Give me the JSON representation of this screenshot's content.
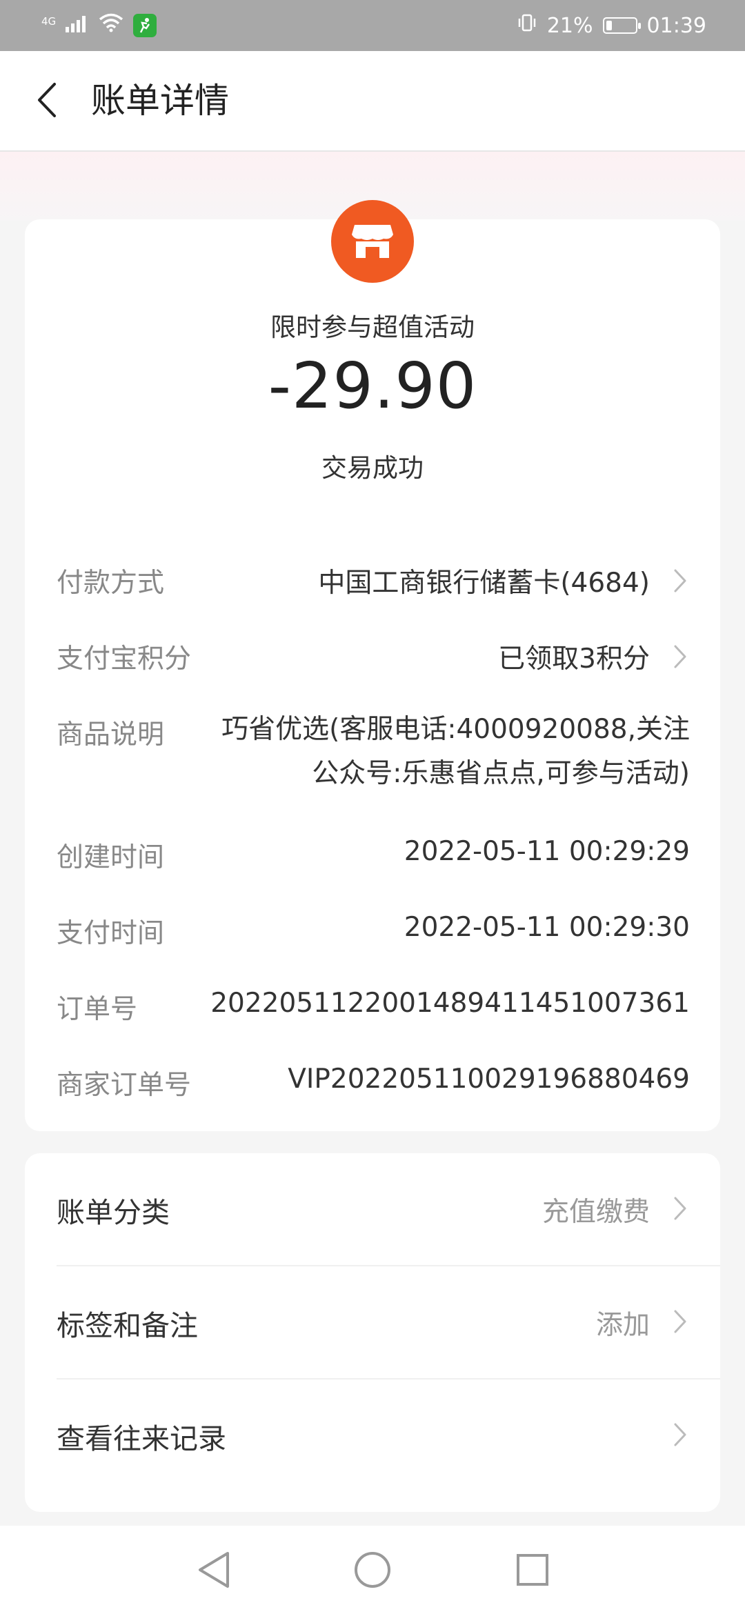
{
  "status_bar": {
    "network": "4G",
    "battery_percent": "21%",
    "battery_level": 0.21,
    "time": "01:39",
    "icons": [
      "signal-icon",
      "wifi-icon",
      "app-notification-icon",
      "vibrate-icon",
      "battery-icon"
    ]
  },
  "header": {
    "title": "账单详情",
    "back_icon": "chevron-left-icon"
  },
  "bill": {
    "merchant_icon": "store-icon",
    "merchant_color": "#f05a22",
    "merchant_name": "限时参与超值活动",
    "amount": "-29.90",
    "status": "交易成功"
  },
  "details": [
    {
      "label": "付款方式",
      "value": "中国工商银行储蓄卡(4684)",
      "arrow": true
    },
    {
      "label": "支付宝积分",
      "value": "已领取3积分",
      "arrow": true
    },
    {
      "label": "商品说明",
      "value": "巧省优选(客服电话:4000920088,关注公众号:乐惠省点点,可参与活动)",
      "arrow": false
    },
    {
      "label": "创建时间",
      "value": "2022-05-11 00:29:29",
      "arrow": false
    },
    {
      "label": "支付时间",
      "value": "2022-05-11 00:29:30",
      "arrow": false
    },
    {
      "label": "订单号",
      "value": "2022051122001489411451007361",
      "arrow": false
    },
    {
      "label": "商家订单号",
      "value": "VIP2022051100291968804​69",
      "arrow": false
    }
  ],
  "actions": [
    {
      "label": "账单分类",
      "value": "充值缴费"
    },
    {
      "label": "标签和备注",
      "value": "添加"
    },
    {
      "label": "查看往来记录",
      "value": ""
    }
  ],
  "nav": [
    "back-triangle-icon",
    "home-circle-icon",
    "recents-square-icon"
  ]
}
